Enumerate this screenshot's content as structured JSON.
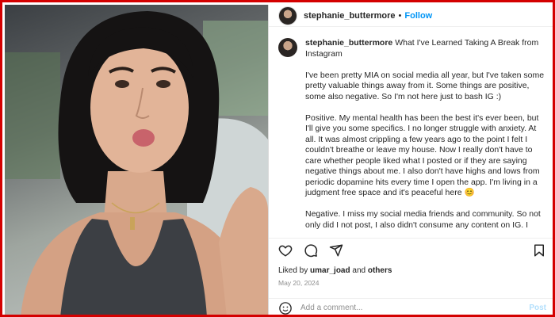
{
  "post": {
    "username": "stephanie_buttermore",
    "follow_label": "Follow",
    "separator": "•"
  },
  "caption": {
    "username": "stephanie_buttermore",
    "title": "What I've Learned Taking A Break from Instagram",
    "paragraphs": [
      "I've been pretty MIA on social media all year, but I've taken some pretty valuable things away from it. Some things are positive, some also negative. So I'm not here just to bash IG :)",
      "Positive. My mental health has been the best it's ever been, but I'll give you some specifics. I no longer struggle with anxiety. At all. It was almost crippling a few years ago to the point I felt I couldn't breathe or leave my house. Now I really don't have to care whether people liked what I posted or if they are saying negative things about me. I also don't have highs and lows from periodic dopamine hits every time I open the app. I'm living in a judgment free space and it's peaceful here 😊",
      "Negative. I miss my social media friends and community. So not only did I not post, I also didn't consume any content on IG. I opened the app maybe once a month and tbh I genuinely"
    ]
  },
  "likes": {
    "prefix": "Liked by",
    "user": "umar_joad",
    "conjunction": "and",
    "others": "others"
  },
  "date": "May 20, 2024",
  "comment": {
    "placeholder": "Add a comment...",
    "post_label": "Post"
  },
  "icons": [
    "heart-icon",
    "comment-icon",
    "share-icon",
    "bookmark-icon",
    "emoji-icon",
    "more-icon"
  ]
}
